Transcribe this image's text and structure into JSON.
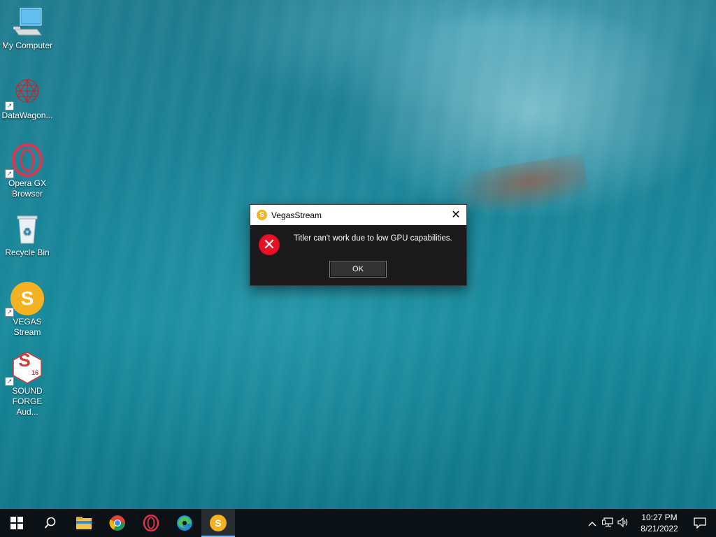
{
  "desktop": {
    "icons": [
      {
        "label": "My Computer",
        "icon": "computer-icon",
        "shortcut": false
      },
      {
        "label": "DataWagon...",
        "icon": "datawagon-icon",
        "shortcut": true
      },
      {
        "label": "Opera GX Browser",
        "icon": "opera-gx-icon",
        "shortcut": true
      },
      {
        "label": "Recycle Bin",
        "icon": "recycle-bin-icon",
        "shortcut": false
      },
      {
        "label": "VEGAS Stream",
        "icon": "vegas-stream-icon",
        "shortcut": true,
        "glyph": "S"
      },
      {
        "label": "SOUND FORGE Aud...",
        "icon": "sound-forge-icon",
        "shortcut": true,
        "glyph": "S",
        "badge": "16"
      }
    ]
  },
  "dialog": {
    "title": "VegasStream",
    "title_icon_glyph": "S",
    "message": "Titler can't work due to low GPU capabilities.",
    "ok_label": "OK",
    "close_glyph": "✕",
    "error_glyph": "✕"
  },
  "taskbar": {
    "buttons": [
      {
        "name": "start-button",
        "icon": "windows-icon"
      },
      {
        "name": "search-button",
        "icon": "search-icon"
      },
      {
        "name": "file-explorer-button",
        "icon": "folder-icon"
      },
      {
        "name": "chrome-button",
        "icon": "chrome-icon"
      },
      {
        "name": "opera-button",
        "icon": "opera-icon"
      },
      {
        "name": "edge-button",
        "icon": "edge-icon"
      },
      {
        "name": "vegas-stream-button",
        "icon": "vegas-stream-icon",
        "active": true,
        "glyph": "S"
      }
    ],
    "tray": {
      "time": "10:27 PM",
      "date": "8/21/2022"
    }
  },
  "colors": {
    "accent": "#76b9ed",
    "error_red": "#e81123",
    "vegas_orange": "#f4b223"
  }
}
